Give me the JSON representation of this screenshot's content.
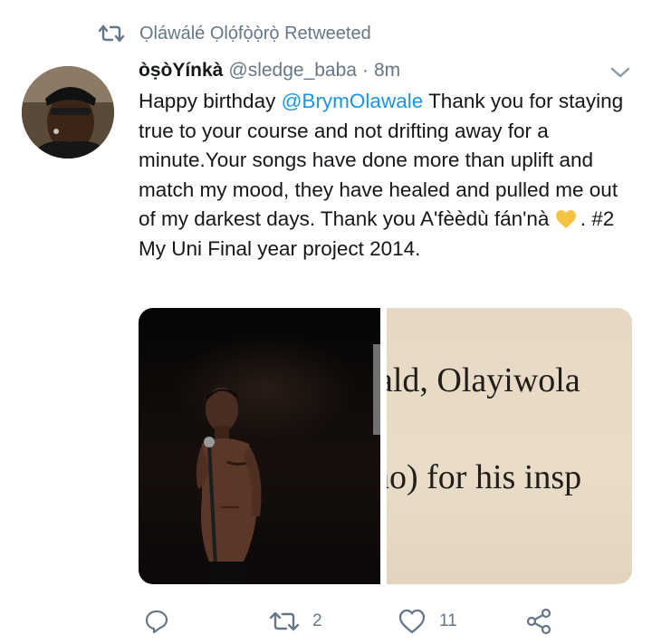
{
  "retweet_banner": {
    "icon": "retweet-icon",
    "text": "Ọláwálé  Ọlọ́fọ̀ọ̀rọ̀ Retweeted"
  },
  "tweet": {
    "author": {
      "display_name": "òṣòYínkà",
      "handle": "@sledge_baba",
      "separator": "·",
      "time": "8m",
      "avatar": "avatar"
    },
    "text": {
      "part1": "Happy birthday ",
      "mention": "@BrymOlawale",
      "part2": " Thank you for staying true to your course and not drifting away for a minute.Your songs have done more than uplift and match my mood, they have healed and pulled me out of my darkest days. Thank you A'fèèdù fán'nà ",
      "emoji": "yellow-heart",
      "part3": ". #2 My Uni Final year project 2014."
    },
    "media": {
      "left_image": "performer-on-stage-photo",
      "right_image_lines": [
        "ald, Olayiwola",
        "no) for his insp"
      ]
    },
    "actions": {
      "reply": {
        "icon": "reply-icon",
        "count": ""
      },
      "retweet": {
        "icon": "retweet-icon",
        "count": "2"
      },
      "like": {
        "icon": "like-icon",
        "count": "11"
      },
      "share": {
        "icon": "share-icon",
        "count": ""
      }
    }
  },
  "colors": {
    "accent": "#1b95e0",
    "muted": "#657786",
    "text": "#14171a",
    "heart": "#f5c445"
  }
}
